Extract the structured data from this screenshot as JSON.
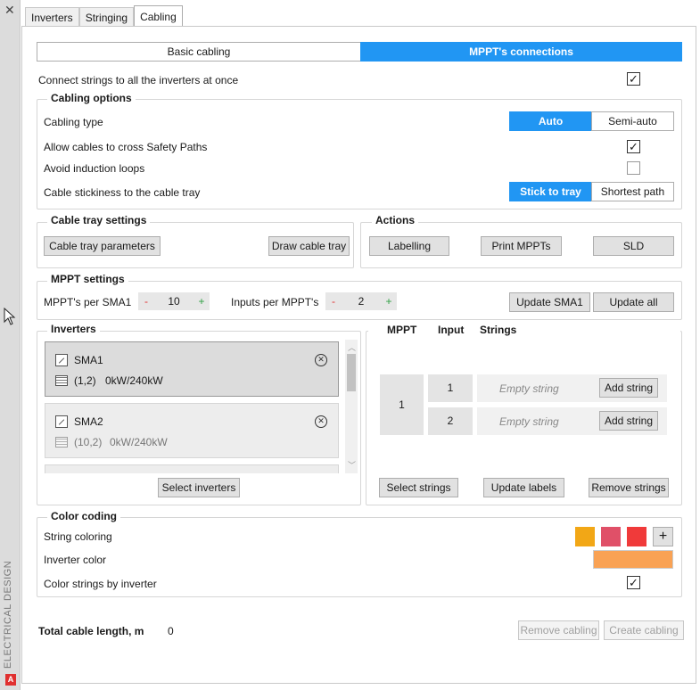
{
  "sidebar": {
    "close_glyph": "✕",
    "vertical_label": "ELECTRICAL DESIGN",
    "badge": "A"
  },
  "tabs": [
    {
      "label": "Inverters"
    },
    {
      "label": "Stringing"
    },
    {
      "label": "Cabling"
    }
  ],
  "mode_toggle": {
    "basic": "Basic cabling",
    "mppt": "MPPT's connections"
  },
  "connect_all": {
    "label": "Connect strings to all the inverters at once",
    "checked": true
  },
  "cabling_options": {
    "title": "Cabling options",
    "cabling_type_label": "Cabling type",
    "cabling_type_options": [
      "Auto",
      "Semi-auto"
    ],
    "cabling_type_selected": "Auto",
    "allow_cross_label": "Allow cables to cross Safety Paths",
    "allow_cross_checked": true,
    "avoid_loops_label": "Avoid induction loops",
    "avoid_loops_checked": false,
    "stickiness_label": "Cable stickiness to the cable tray",
    "stickiness_options": [
      "Stick to tray",
      "Shortest path"
    ],
    "stickiness_selected": "Stick to tray"
  },
  "cable_tray": {
    "title": "Cable tray settings",
    "params_button": "Cable tray parameters",
    "draw_button": "Draw cable tray"
  },
  "actions": {
    "title": "Actions",
    "labelling": "Labelling",
    "print": "Print MPPTs",
    "sld": "SLD"
  },
  "mppt_settings": {
    "title": "MPPT settings",
    "mppt_per_label": "MPPT's per SMA1",
    "mppt_per_value": "10",
    "inputs_per_label": "Inputs per MPPT's",
    "inputs_per_value": "2",
    "minus": "-",
    "plus": "+",
    "update_one": "Update SMA1",
    "update_all": "Update all"
  },
  "inverters": {
    "title": "Inverters",
    "items": [
      {
        "name": "SMA1",
        "coords": "(1,2)",
        "power": "0kW/240kW",
        "selected": true
      },
      {
        "name": "SMA2",
        "coords": "(10,2)",
        "power": "0kW/240kW",
        "selected": false
      }
    ],
    "select_button": "Select inverters"
  },
  "mppt_table": {
    "headers": [
      "MPPT",
      "Input",
      "Strings"
    ],
    "mppt_number": "1",
    "inputs": [
      {
        "input": "1",
        "string": "Empty string",
        "add": "Add string"
      },
      {
        "input": "2",
        "string": "Empty string",
        "add": "Add string"
      }
    ],
    "select_strings": "Select strings",
    "update_labels": "Update labels",
    "remove_strings": "Remove strings"
  },
  "color_coding": {
    "title": "Color coding",
    "string_coloring_label": "String coloring",
    "swatches": [
      "#f2a716",
      "#e05068",
      "#f03a3a"
    ],
    "add_glyph": "+",
    "inverter_color_label": "Inverter color",
    "inverter_color": "#f9a254",
    "by_inverter_label": "Color strings by inverter",
    "by_inverter_checked": true
  },
  "footer": {
    "total_label": "Total cable length, m",
    "total_value": "0",
    "remove_button": "Remove cabling",
    "create_button": "Create cabling"
  },
  "colors": {
    "accent": "#2196f3"
  }
}
